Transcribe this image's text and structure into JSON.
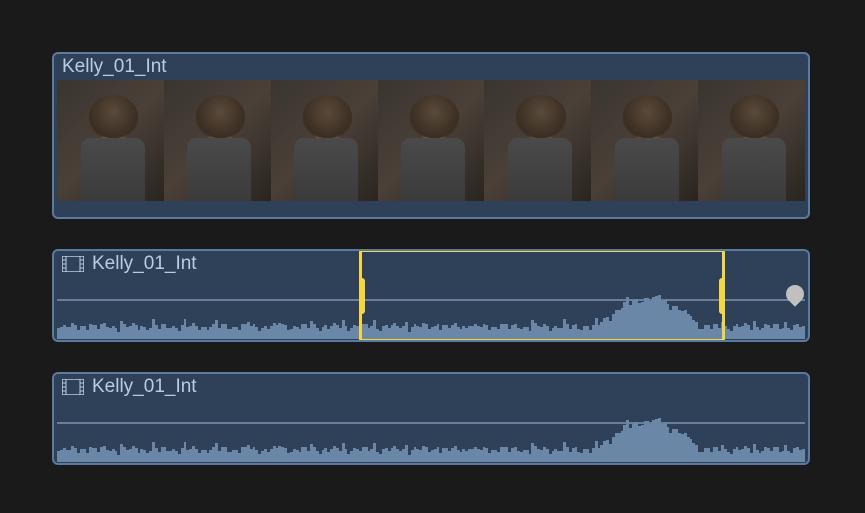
{
  "clips": [
    {
      "name": "Kelly_01_Int",
      "type": "video",
      "thumbnails": 7
    },
    {
      "name": "Kelly_01_Int",
      "type": "audio",
      "hasSelection": true,
      "hasMarker": true,
      "selection": {
        "start_pct": 40.5,
        "end_pct": 89
      }
    },
    {
      "name": "Kelly_01_Int",
      "type": "audio"
    }
  ],
  "colors": {
    "selection": "#f5d542",
    "clip_bg": "#2e4159",
    "clip_border": "#5a7a9e",
    "text": "#b8cde4"
  }
}
